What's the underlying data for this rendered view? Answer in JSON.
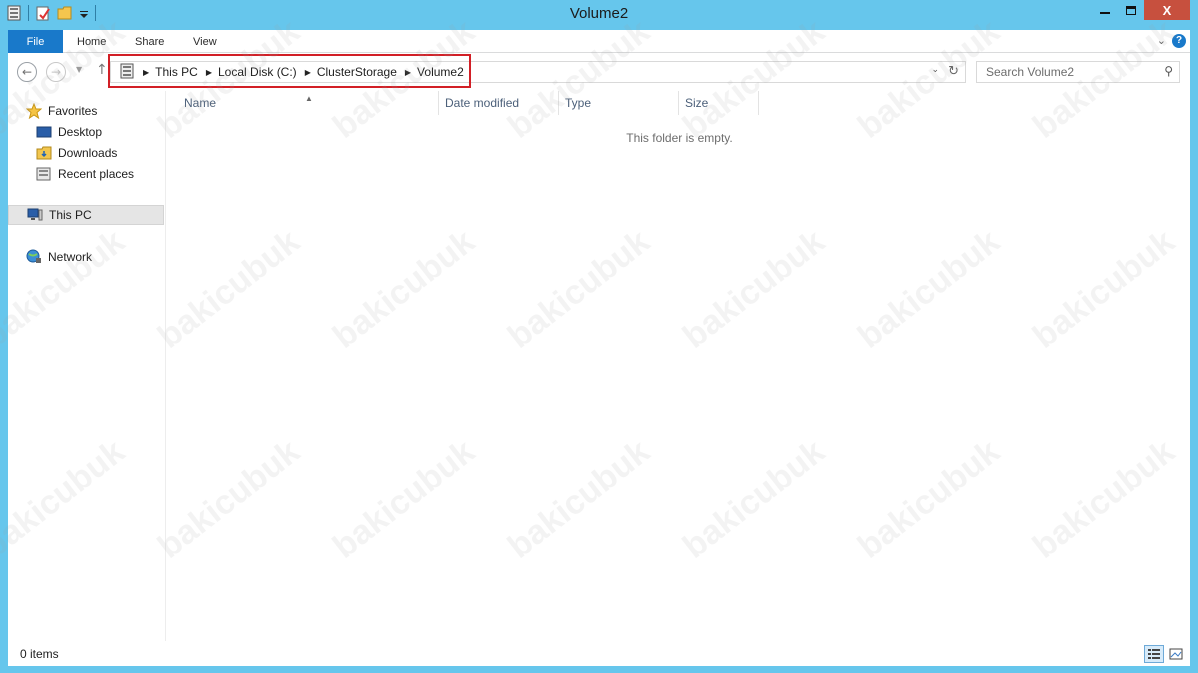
{
  "window": {
    "title": "Volume2",
    "close_glyph": "X"
  },
  "ribbon": {
    "tabs": [
      {
        "label": "File"
      },
      {
        "label": "Home"
      },
      {
        "label": "Share"
      },
      {
        "label": "View"
      }
    ],
    "help_glyph": "?"
  },
  "address": {
    "breadcrumbs": [
      "This PC",
      "Local Disk (C:)",
      "ClusterStorage",
      "Volume2"
    ],
    "highlight_color": "#d21f26"
  },
  "search": {
    "placeholder": "Search Volume2"
  },
  "navpane": {
    "favorites": {
      "label": "Favorites",
      "icon": "star-icon"
    },
    "favorite_items": [
      {
        "label": "Desktop",
        "icon": "desktop-icon"
      },
      {
        "label": "Downloads",
        "icon": "downloads-folder-icon"
      },
      {
        "label": "Recent places",
        "icon": "recent-places-icon"
      }
    ],
    "this_pc": {
      "label": "This PC",
      "icon": "computer-icon",
      "selected": true
    },
    "network": {
      "label": "Network",
      "icon": "network-icon"
    }
  },
  "columns": [
    {
      "label": "Name"
    },
    {
      "label": "Date modified"
    },
    {
      "label": "Type"
    },
    {
      "label": "Size"
    }
  ],
  "content": {
    "empty_message": "This folder is empty."
  },
  "statusbar": {
    "item_count": "0 items"
  },
  "watermark": {
    "text": "bakicubuk"
  },
  "colors": {
    "titlebar": "#66c6ec",
    "file_tab": "#1979ca",
    "close_button": "#c7503e"
  }
}
